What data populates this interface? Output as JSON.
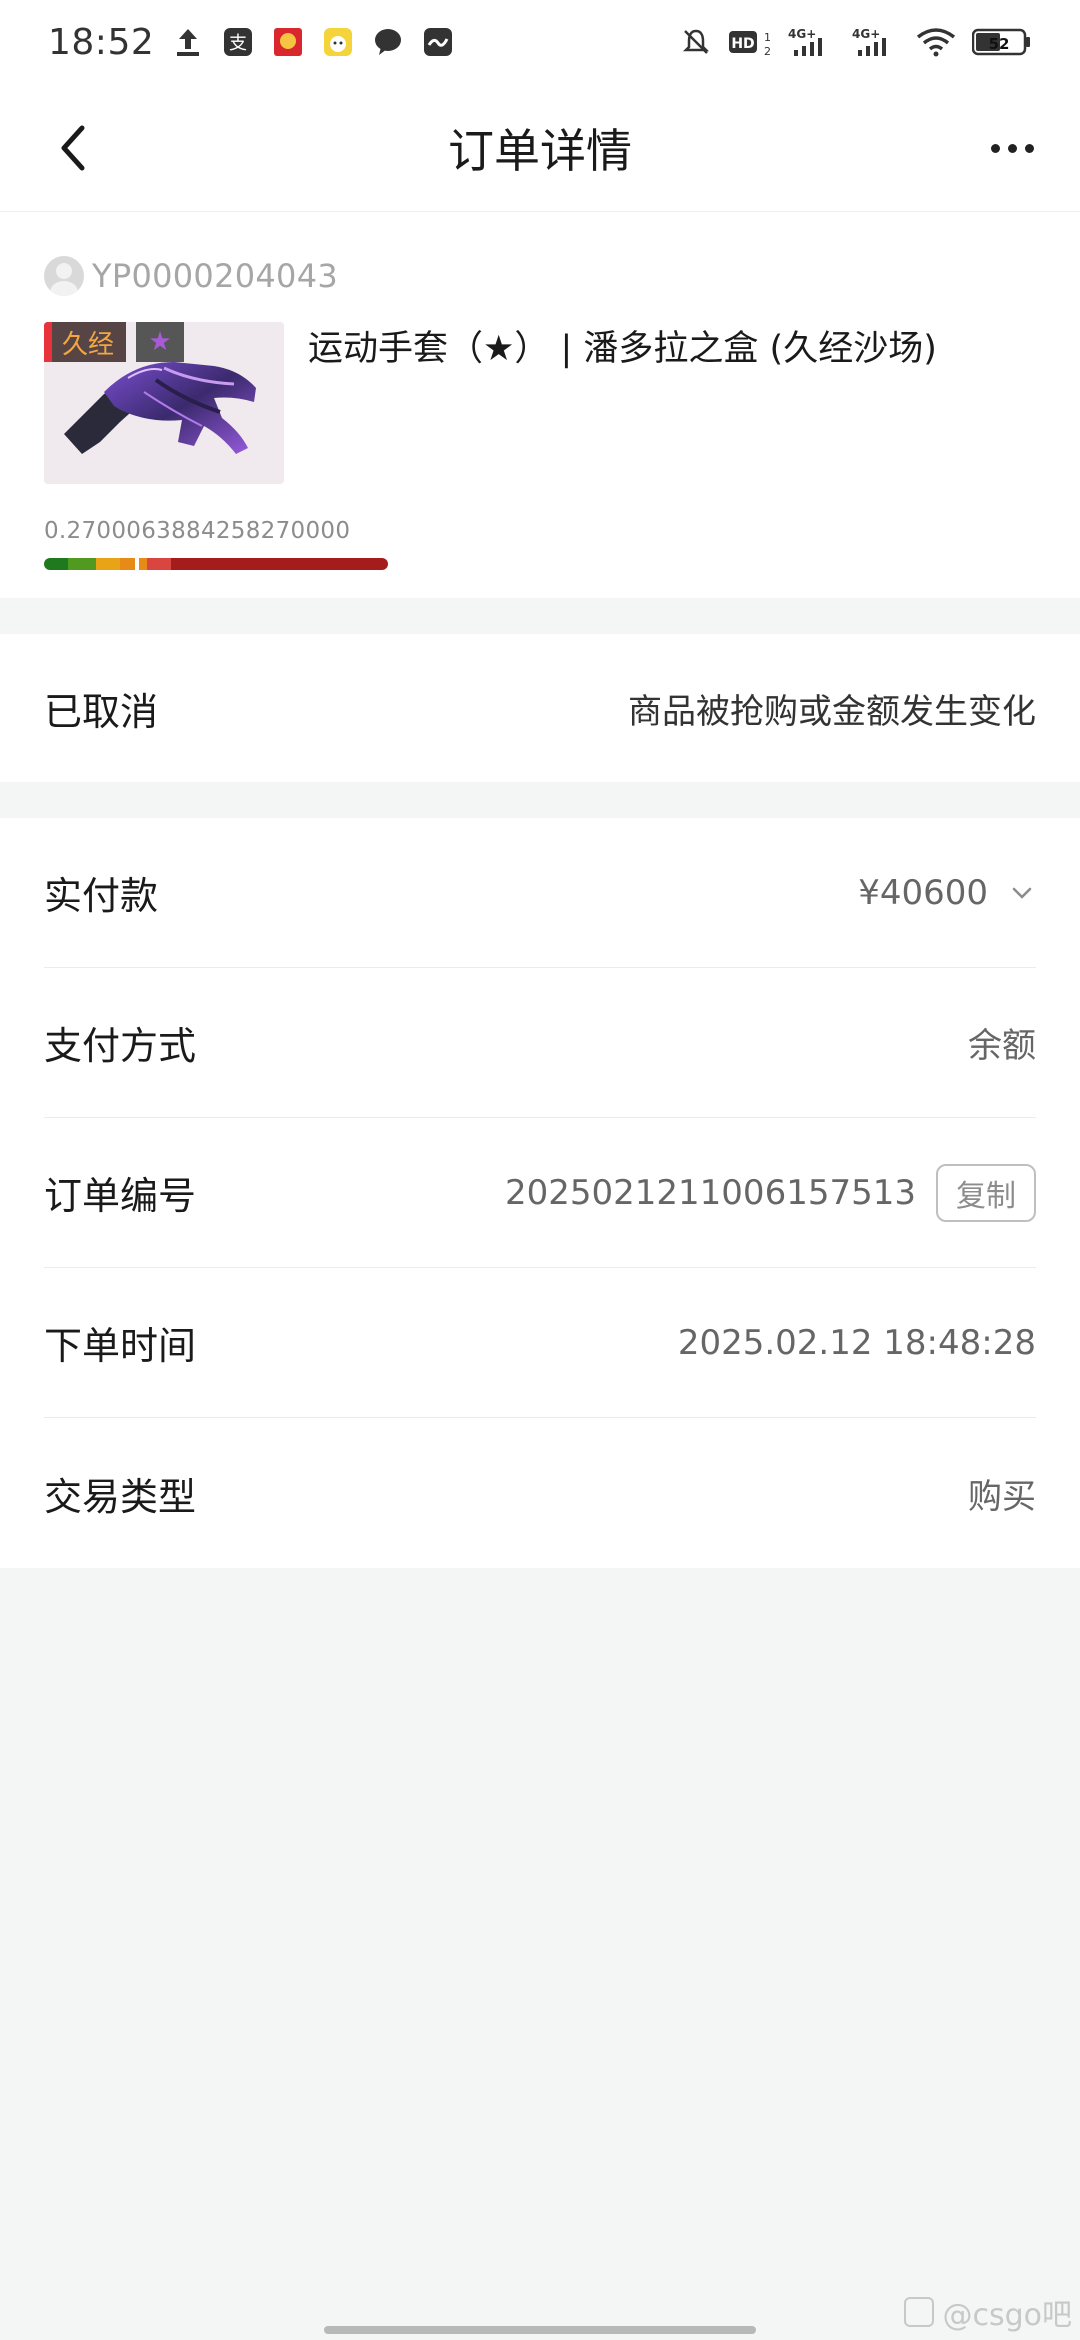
{
  "status_bar": {
    "time": "18:52",
    "battery": "52",
    "network_1": "4G+",
    "network_2": "4G+",
    "hd": "HD",
    "icons": [
      "upload-icon",
      "alipay-icon",
      "app-icon-red",
      "app-icon-yellow",
      "chat-icon",
      "app-icon-dark",
      "bell-off-icon",
      "hd-icon",
      "signal-icon",
      "signal-icon",
      "wifi-icon",
      "battery-icon"
    ]
  },
  "nav": {
    "title": "订单详情",
    "back_icon": "chevron-left-icon",
    "more_icon": "more-icon"
  },
  "product": {
    "seller_id": "YP0000204043",
    "wear_tag": "久经",
    "star_tag": "★",
    "name": "运动手套（★） | 潘多拉之盒 (久经沙场)",
    "float_value": "0.2700063884258270000",
    "float_fraction": 0.27,
    "wear_colors": [
      "#1f7a1f",
      "#4f9a1f",
      "#e8a317",
      "#e88a17",
      "#d9463f",
      "#a51c1c"
    ]
  },
  "order_status": {
    "label": "已取消",
    "reason": "商品被抢购或金额发生变化"
  },
  "details": {
    "paid_label": "实付款",
    "paid_value": "¥40600",
    "payment_label": "支付方式",
    "payment_value": "余额",
    "order_no_label": "订单编号",
    "order_no_value": "2025021211006157513",
    "copy_label": "复制",
    "time_label": "下单时间",
    "time_value": "2025.02.12 18:48:28",
    "type_label": "交易类型",
    "type_value": "购买"
  },
  "watermark": "@csgo吧"
}
